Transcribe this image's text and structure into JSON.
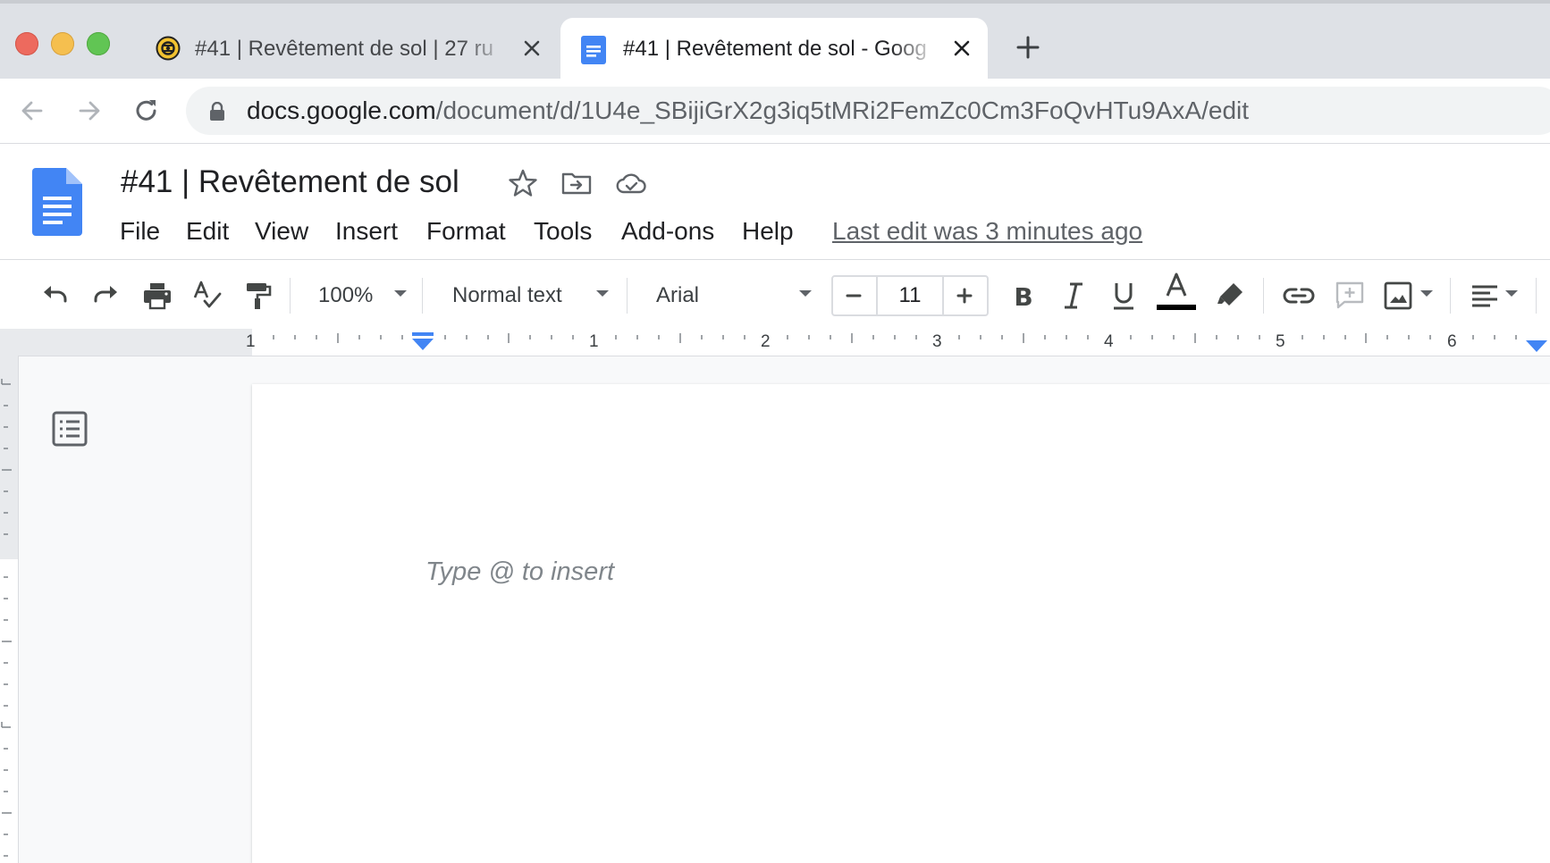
{
  "browser": {
    "tabs": [
      {
        "title": "#41 | Revêtement de sol | 27 ru",
        "favicon": "site-favicon-icon",
        "active": false
      },
      {
        "title": "#41 | Revêtement de sol - Goog",
        "favicon": "google-docs-icon",
        "active": true
      }
    ],
    "url_host": "docs.google.com",
    "url_path": "/document/d/1U4e_SBijiGrX2g3iq5tMRi2FemZc0Cm3FoQvHTu9AxA/edit"
  },
  "doc": {
    "title": "#41 | Revêtement de sol",
    "menu": [
      "File",
      "Edit",
      "View",
      "Insert",
      "Format",
      "Tools",
      "Add-ons",
      "Help"
    ],
    "last_edit": "Last edit was 3 minutes ago",
    "placeholder": "Type @ to insert"
  },
  "toolbar": {
    "zoom": "100%",
    "style": "Normal text",
    "font": "Arial",
    "font_size": "11",
    "text_color": "#000000"
  },
  "ruler": {
    "labels": [
      "1",
      "1",
      "2",
      "3",
      "4",
      "5",
      "6"
    ]
  },
  "colors": {
    "accent": "#4285f4",
    "tab_strip": "#dee1e6",
    "close": "#ed6a5e",
    "minimize": "#f5bf4f",
    "maximize": "#61c554"
  }
}
